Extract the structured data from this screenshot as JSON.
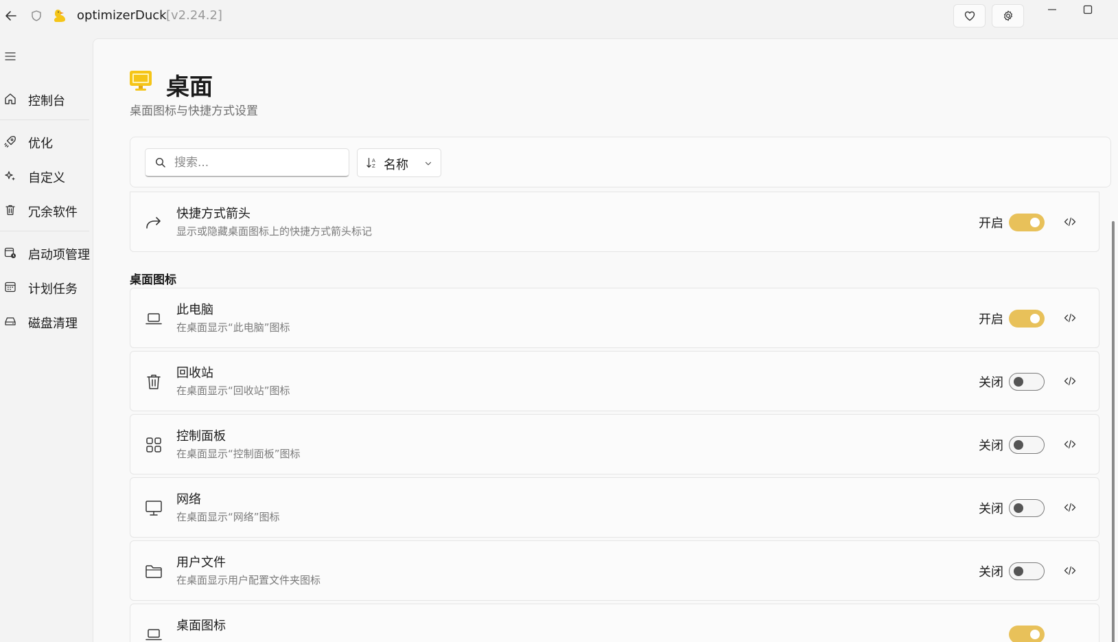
{
  "titlebar": {
    "app_name": "optimizerDuck",
    "version": "[v2.24.2]"
  },
  "sidebar": {
    "items": [
      {
        "label": "控制台",
        "icon": "home-icon"
      },
      {
        "label": "优化",
        "icon": "rocket-icon"
      },
      {
        "label": "自定义",
        "icon": "sparkle-icon"
      },
      {
        "label": "冗余软件",
        "icon": "trash-icon"
      },
      {
        "label": "启动项管理",
        "icon": "startup-app-icon"
      },
      {
        "label": "计划任务",
        "icon": "calendar-icon"
      },
      {
        "label": "磁盘清理",
        "icon": "drive-icon"
      }
    ]
  },
  "page": {
    "title": "桌面",
    "subtitle": "桌面图标与快捷方式设置"
  },
  "toolbar": {
    "search_placeholder": "搜索...",
    "sort_label": "名称"
  },
  "section_heading": "桌面图标",
  "accent_color": "#e8c15a",
  "cards": [
    {
      "title": "快捷方式箭头",
      "desc": "显示或隐藏桌面图标上的快捷方式箭头标记",
      "state": "开启",
      "on": true,
      "icon": "share-arrow-icon"
    },
    {
      "title": "此电脑",
      "desc": "在桌面显示“此电脑”图标",
      "state": "开启",
      "on": true,
      "icon": "laptop-icon"
    },
    {
      "title": "回收站",
      "desc": "在桌面显示“回收站”图标",
      "state": "关闭",
      "on": false,
      "icon": "recycle-bin-icon"
    },
    {
      "title": "控制面板",
      "desc": "在桌面显示“控制面板”图标",
      "state": "关闭",
      "on": false,
      "icon": "grid-icon"
    },
    {
      "title": "网络",
      "desc": "在桌面显示“网络”图标",
      "state": "关闭",
      "on": false,
      "icon": "monitor-icon"
    },
    {
      "title": "用户文件",
      "desc": "在桌面显示用户配置文件夹图标",
      "state": "关闭",
      "on": false,
      "icon": "folder-icon"
    },
    {
      "title": "桌面图标",
      "desc": "",
      "state": "",
      "on": true,
      "icon": "laptop-icon"
    }
  ]
}
